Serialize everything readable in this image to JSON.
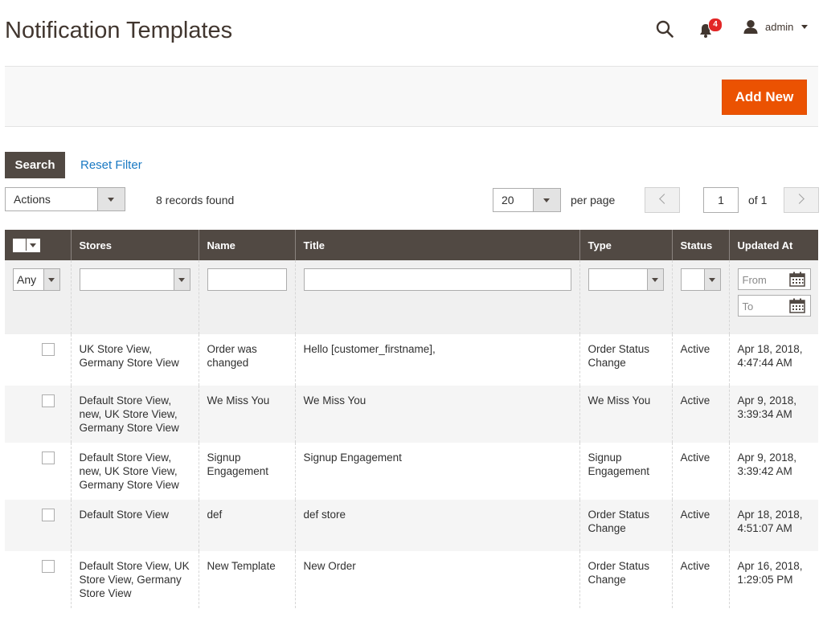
{
  "header": {
    "title": "Notification Templates",
    "notifications_count": "4",
    "user_name": "admin"
  },
  "toolbar": {
    "add_new_label": "Add New",
    "search_label": "Search",
    "reset_filter_label": "Reset Filter",
    "actions_label": "Actions",
    "records_found": "8 records found",
    "per_page_value": "20",
    "per_page_label": "per page",
    "current_page": "1",
    "total_pages_label": "of 1"
  },
  "grid": {
    "columns": {
      "stores": "Stores",
      "name": "Name",
      "title": "Title",
      "type": "Type",
      "status": "Status",
      "updated_at": "Updated At"
    },
    "filters": {
      "any_label": "Any",
      "from_placeholder": "From",
      "to_placeholder": "To"
    },
    "rows": [
      {
        "stores": "UK Store View, Germany Store View",
        "name": "Order was changed",
        "title": "Hello [customer_firstname],",
        "type": "Order Status Change",
        "status": "Active",
        "updated_at": "Apr 18, 2018, 4:47:44 AM"
      },
      {
        "stores": "Default Store View, new, UK Store View, Germany Store View",
        "name": "We Miss You",
        "title": "We Miss You",
        "type": "We Miss You",
        "status": "Active",
        "updated_at": "Apr 9, 2018, 3:39:34 AM"
      },
      {
        "stores": "Default Store View, new, UK Store View, Germany Store View",
        "name": "Signup Engagement",
        "title": "Signup Engagement",
        "type": "Signup Engagement",
        "status": "Active",
        "updated_at": "Apr 9, 2018, 3:39:42 AM"
      },
      {
        "stores": "Default Store View",
        "name": "def",
        "title": "def store",
        "type": "Order Status Change",
        "status": "Active",
        "updated_at": "Apr 18, 2018, 4:51:07 AM"
      },
      {
        "stores": "Default Store View, UK Store View, Germany Store View",
        "name": "New Template",
        "title": "New Order",
        "type": "Order Status Change",
        "status": "Active",
        "updated_at": "Apr 16, 2018, 1:29:05 PM"
      }
    ]
  },
  "colors": {
    "accent": "#eb5202",
    "header_dark": "#514943",
    "link": "#1979c3",
    "badge": "#e22626"
  },
  "icons": {
    "search": "search-icon",
    "bell": "bell-icon",
    "user": "user-icon",
    "calendar": "calendar-icon"
  }
}
